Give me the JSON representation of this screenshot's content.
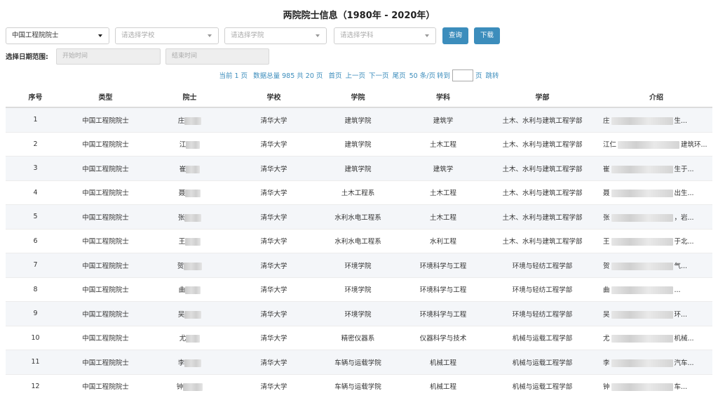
{
  "title": "两院院士信息（1980年 - 2020年）",
  "filters": {
    "type_select": "中国工程院院士",
    "school_placeholder": "请选择学校",
    "college_placeholder": "请选择学院",
    "discipline_placeholder": "请选择学科",
    "search_label": "查询",
    "download_label": "下载"
  },
  "date_range": {
    "label": "选择日期范围:",
    "start_placeholder": "开始时间",
    "end_placeholder": "结束时间"
  },
  "pager": {
    "current": "当前 1 页",
    "total": "数据总量 985 共 20 页",
    "first": "首页",
    "prev": "上一页",
    "next": "下一页",
    "last": "尾页",
    "page_size": "50 条/页",
    "goto": "转到",
    "page_unit": "页",
    "jump": "跳转"
  },
  "table": {
    "headers": [
      "序号",
      "类型",
      "院士",
      "学校",
      "学院",
      "学科",
      "学部",
      "介绍"
    ],
    "rows": [
      {
        "no": "1",
        "type": "中国工程院院士",
        "name": "庄",
        "school": "清华大学",
        "college": "建筑学院",
        "discipline": "建筑学",
        "division": "土木、水利与建筑工程学部",
        "intro_start": "庄",
        "intro_end": "生..."
      },
      {
        "no": "2",
        "type": "中国工程院院士",
        "name": "江",
        "school": "清华大学",
        "college": "建筑学院",
        "discipline": "土木工程",
        "division": "土木、水利与建筑工程学部",
        "intro_start": "江仁",
        "intro_end": "建筑环..."
      },
      {
        "no": "3",
        "type": "中国工程院院士",
        "name": "崔",
        "school": "清华大学",
        "college": "建筑学院",
        "discipline": "建筑学",
        "division": "土木、水利与建筑工程学部",
        "intro_start": "崔",
        "intro_end": "生于..."
      },
      {
        "no": "4",
        "type": "中国工程院院士",
        "name": "聂",
        "school": "清华大学",
        "college": "土木工程系",
        "discipline": "土木工程",
        "division": "土木、水利与建筑工程学部",
        "intro_start": "聂",
        "intro_end": "出生..."
      },
      {
        "no": "5",
        "type": "中国工程院院士",
        "name": "张",
        "school": "清华大学",
        "college": "水利水电工程系",
        "discipline": "土木工程",
        "division": "土木、水利与建筑工程学部",
        "intro_start": "张",
        "intro_end": "，岩..."
      },
      {
        "no": "6",
        "type": "中国工程院院士",
        "name": "王",
        "school": "清华大学",
        "college": "水利水电工程系",
        "discipline": "水利工程",
        "division": "土木、水利与建筑工程学部",
        "intro_start": "王",
        "intro_end": "于北..."
      },
      {
        "no": "7",
        "type": "中国工程院院士",
        "name": "贺",
        "school": "清华大学",
        "college": "环境学院",
        "discipline": "环境科学与工程",
        "division": "环境与轻纺工程学部",
        "intro_start": "贺",
        "intro_end": "气..."
      },
      {
        "no": "8",
        "type": "中国工程院院士",
        "name": "曲",
        "school": "清华大学",
        "college": "环境学院",
        "discipline": "环境科学与工程",
        "division": "环境与轻纺工程学部",
        "intro_start": "曲",
        "intro_end": "..."
      },
      {
        "no": "9",
        "type": "中国工程院院士",
        "name": "吴",
        "school": "清华大学",
        "college": "环境学院",
        "discipline": "环境科学与工程",
        "division": "环境与轻纺工程学部",
        "intro_start": "吴",
        "intro_end": "环..."
      },
      {
        "no": "10",
        "type": "中国工程院院士",
        "name": "尤",
        "school": "清华大学",
        "college": "精密仪器系",
        "discipline": "仪器科学与技术",
        "division": "机械与运载工程学部",
        "intro_start": "尤",
        "intro_end": "机械..."
      },
      {
        "no": "11",
        "type": "中国工程院院士",
        "name": "李",
        "school": "清华大学",
        "college": "车辆与运载学院",
        "discipline": "机械工程",
        "division": "机械与运载工程学部",
        "intro_start": "李",
        "intro_end": "汽车..."
      },
      {
        "no": "12",
        "type": "中国工程院院士",
        "name": "钟",
        "school": "清华大学",
        "college": "车辆与运载学院",
        "discipline": "机械工程",
        "division": "机械与运载工程学部",
        "intro_start": "钟",
        "intro_end": "车..."
      }
    ]
  }
}
